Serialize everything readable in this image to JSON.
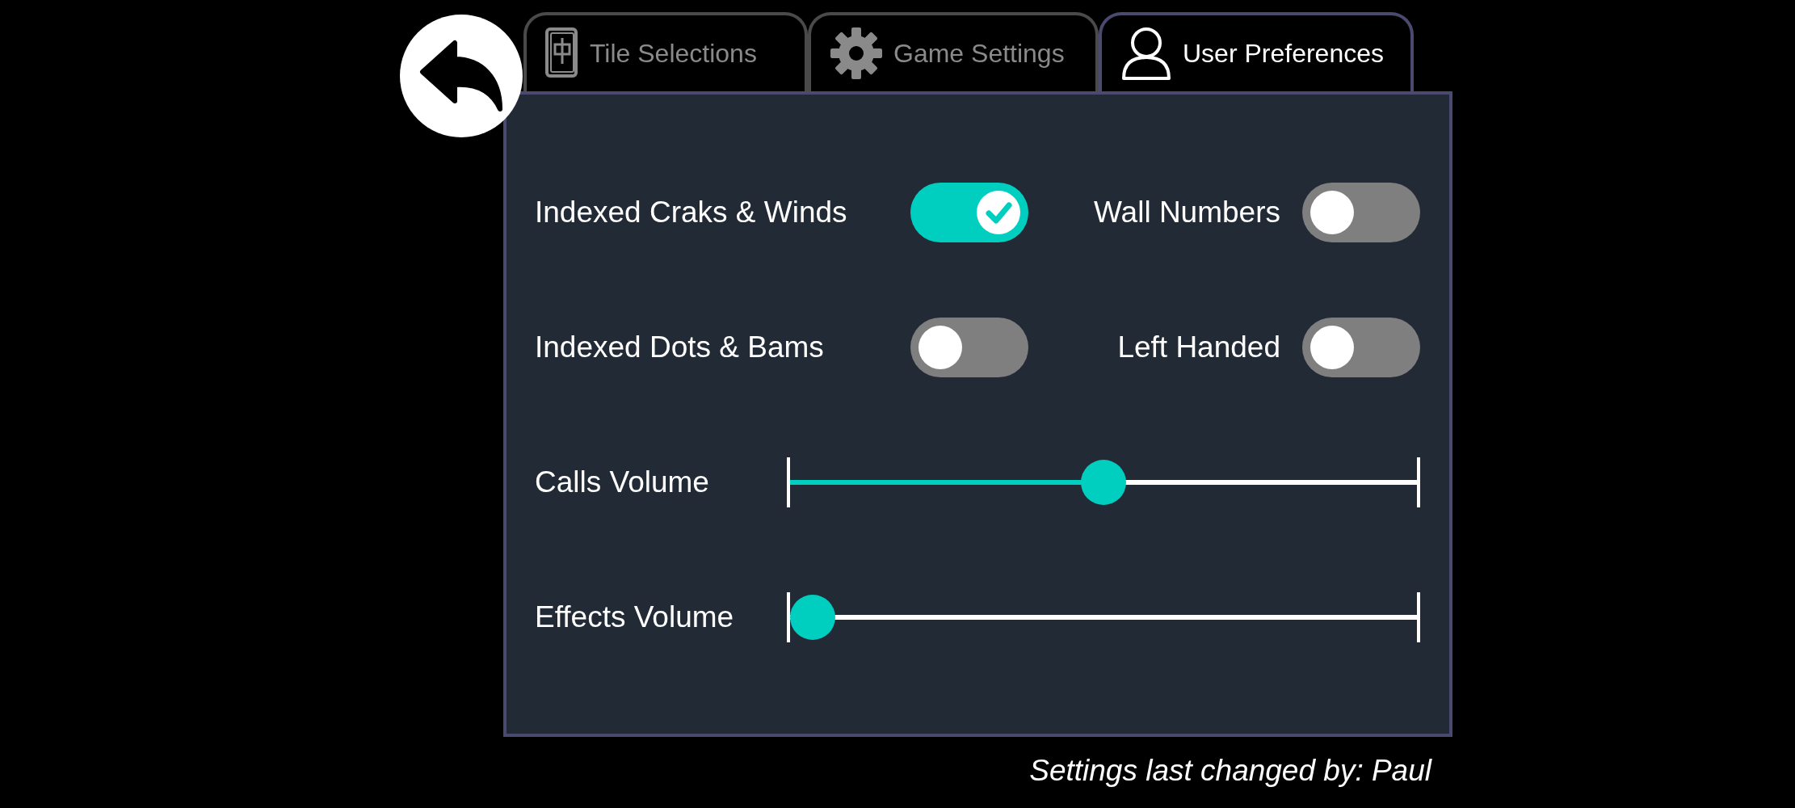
{
  "tabs": [
    {
      "label": "Tile Selections",
      "kind": "tiles",
      "selected": false
    },
    {
      "label": "Game Settings",
      "kind": "gear",
      "selected": false
    },
    {
      "label": "User Preferences",
      "kind": "user",
      "selected": true
    }
  ],
  "toggles": [
    {
      "label": "Indexed Craks & Winds",
      "on": true
    },
    {
      "label": "Wall Numbers",
      "on": false
    },
    {
      "label": "Indexed Dots & Bams",
      "on": false
    },
    {
      "label": "Left Handed",
      "on": false
    }
  ],
  "sliders": [
    {
      "label": "Calls Volume",
      "level": 0.5
    },
    {
      "label": "Effects Volume",
      "level": 0
    }
  ],
  "footer": "Settings last changed by: Paul"
}
